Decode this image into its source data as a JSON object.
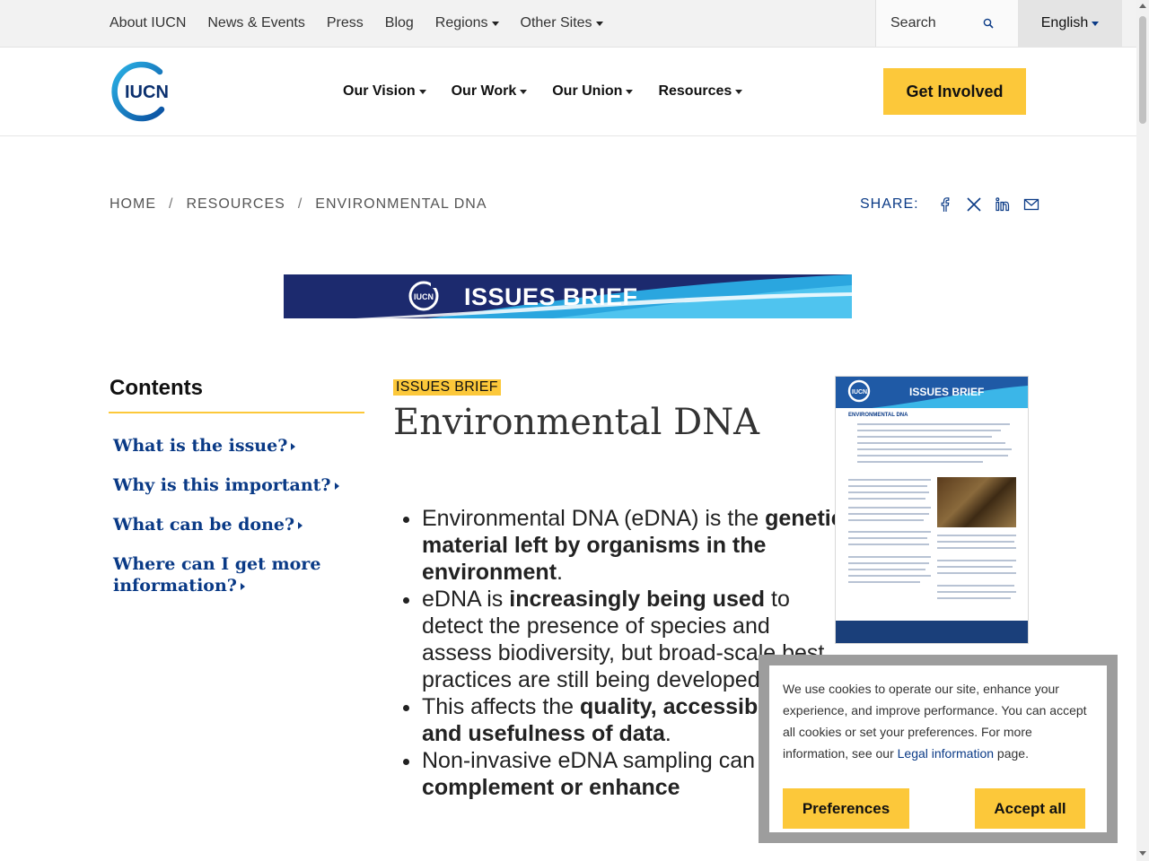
{
  "top_nav": {
    "items": [
      "About IUCN",
      "News & Events",
      "Press",
      "Blog",
      "Regions",
      "Other Sites"
    ],
    "search_label": "Search",
    "language": "English"
  },
  "main_nav": {
    "logo_text": "IUCN",
    "items": [
      "Our Vision",
      "Our Work",
      "Our Union",
      "Resources"
    ],
    "cta": "Get Involved"
  },
  "breadcrumb": [
    "HOME",
    "RESOURCES",
    "ENVIRONMENTAL DNA"
  ],
  "share": {
    "label": "SHARE:",
    "icons": [
      "facebook-icon",
      "x-icon",
      "linkedin-icon",
      "email-icon"
    ]
  },
  "banner": {
    "logo_text": "IUCN",
    "title": "ISSUES BRIEF"
  },
  "contents": {
    "title": "Contents",
    "items": [
      "What is the issue?",
      "Why is this important?",
      "What can be done?",
      "Where can I get more information?"
    ]
  },
  "article": {
    "tag": "ISSUES BRIEF",
    "title": "Environmental DNA",
    "bullets": [
      {
        "before": "Environmental DNA (eDNA) is the ",
        "bold": "genetic material left by organisms in the environment",
        "after": "."
      },
      {
        "before": "eDNA is ",
        "bold": "increasingly being used",
        "after": " to detect the presence of species and assess biodiversity, but broad-scale best practices are still being developed."
      },
      {
        "before": "This affects the ",
        "bold": "quality, accessibility, and usefulness of data",
        "after": "."
      },
      {
        "before": "Non-invasive eDNA sampling can ",
        "bold": "complement or enhance",
        "after": ""
      }
    ]
  },
  "thumbnail": {
    "logo_text": "IUCN",
    "title": "ISSUES BRIEF",
    "subtitle": "ENVIRONMENTAL DNA"
  },
  "cookie": {
    "text": "We use cookies to operate our site, enhance your experience, and improve performance. You can accept all cookies or set your preferences. For more information, see our ",
    "link": "Legal information",
    "after": " page.",
    "preferences": "Preferences",
    "accept": "Accept all"
  },
  "colors": {
    "accent_yellow": "#fcc83a",
    "navy": "#0a3a86",
    "banner_bg": "#1c2a6e"
  }
}
